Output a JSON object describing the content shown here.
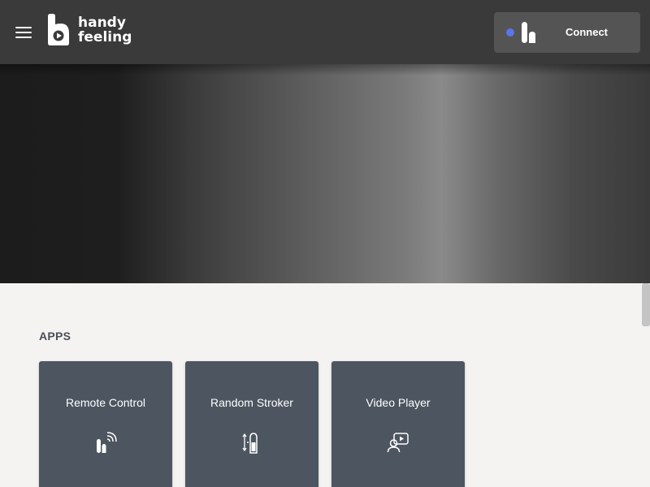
{
  "header": {
    "menu_icon": "hamburger-menu-icon",
    "logo": {
      "line1": "handy",
      "line2": "feeling",
      "icon": "handy-logo-icon"
    },
    "connect": {
      "label": "Connect",
      "status_color": "#5b74e8",
      "device_icon": "handy-device-icon"
    }
  },
  "apps": {
    "title": "APPS",
    "items": [
      {
        "label": "Remote Control",
        "icon": "remote-control-icon"
      },
      {
        "label": "Random Stroker",
        "icon": "random-stroker-icon"
      },
      {
        "label": "Video Player",
        "icon": "video-player-icon"
      }
    ]
  },
  "colors": {
    "header_bg": "#3a3a3a",
    "card_bg": "#4d5660",
    "page_bg": "#f5f3f1",
    "accent": "#5b74e8"
  }
}
